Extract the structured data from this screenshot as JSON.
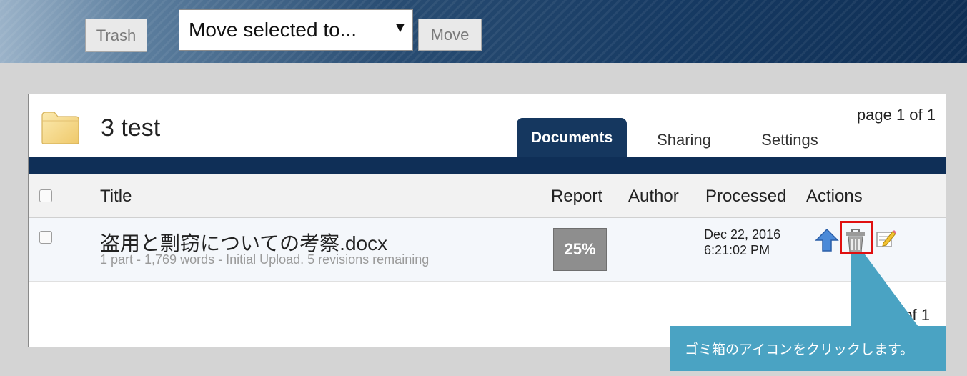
{
  "toolbar": {
    "trash_label": "Trash",
    "move_select_value": "Move selected to...",
    "move_label": "Move"
  },
  "folder": {
    "title": "3 test",
    "icon": "folder-icon"
  },
  "pagination": {
    "top": "page 1 of 1",
    "bottom": "page 1 of 1"
  },
  "tabs": [
    {
      "label": "Documents",
      "active": true
    },
    {
      "label": "Sharing",
      "active": false
    },
    {
      "label": "Settings",
      "active": false
    }
  ],
  "table": {
    "columns": [
      "Title",
      "Report",
      "Author",
      "Processed",
      "Actions"
    ],
    "rows": [
      {
        "title": "盗用と剽窃についての考察.docx",
        "subtitle": "1 part - 1,769 words - Initial Upload. 5 revisions remaining",
        "report": "25%",
        "author": "",
        "processed_date": "Dec 22, 2016",
        "processed_time": "6:21:02 PM",
        "actions": [
          "upload-arrow-icon",
          "trash-can-icon",
          "edit-pencil-icon"
        ]
      }
    ]
  },
  "callout": {
    "text": "ゴミ箱のアイコンをクリックします。"
  },
  "colors": {
    "header_dark": "#0f2f57",
    "callout": "#4aa3c3",
    "highlight": "#e01010"
  }
}
